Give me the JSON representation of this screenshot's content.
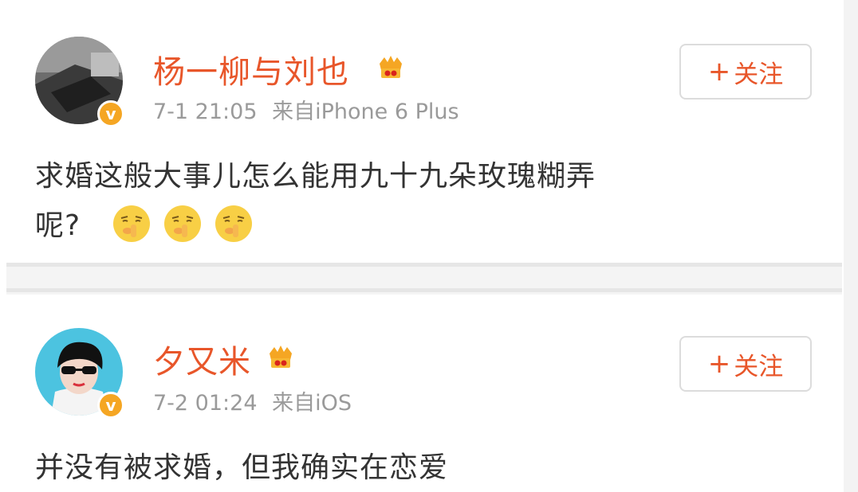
{
  "posts": [
    {
      "username": "杨一柳与刘也",
      "time": "7-1 21:05",
      "source": "来自iPhone 6 Plus",
      "follow_plus": "+",
      "follow_label": "关注",
      "verified_mark": "v",
      "content_line1": "求婚这般大事儿怎么能用九十九朵玫瑰糊弄",
      "content_line2": "呢?",
      "emojis": [
        "shush-emoji",
        "shush-emoji",
        "shush-emoji"
      ]
    },
    {
      "username": "夕又米",
      "time": "7-2 01:24",
      "source": "来自iOS",
      "follow_plus": "+",
      "follow_label": "关注",
      "verified_mark": "v",
      "content_line1": "并没有被求婚，但我确实在恋爱"
    }
  ],
  "colors": {
    "accent": "#e8562a",
    "meta": "#9a9a9a",
    "badge": "#f5a623",
    "separator": "#f4f4f4"
  }
}
